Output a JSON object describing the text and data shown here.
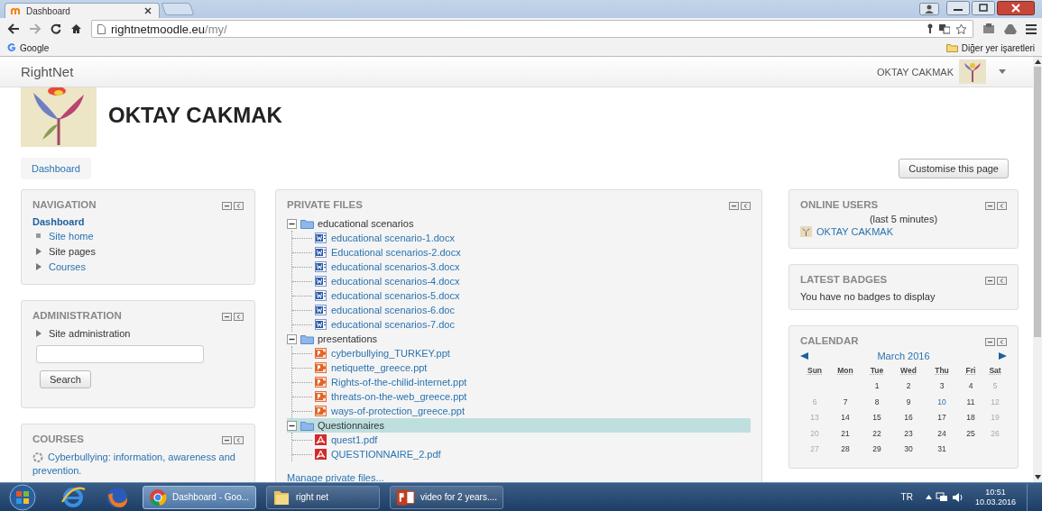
{
  "browser": {
    "tab": {
      "title": "Dashboard"
    },
    "address": {
      "host": "rightnetmoodle.eu",
      "path": "/my/"
    },
    "bookmarks": {
      "items": [
        "Google"
      ],
      "other": "Diğer yer işaretleri"
    }
  },
  "navbar": {
    "brand": "RightNet",
    "user": "OKTAY CAKMAK"
  },
  "header": {
    "name": "OKTAY CAKMAK"
  },
  "breadcrumb": [
    "Dashboard"
  ],
  "customise_button": "Customise this page",
  "navigation": {
    "title": "NAVIGATION",
    "current": "Dashboard",
    "items": [
      {
        "label": "Site home",
        "kind": "leaf",
        "link": true
      },
      {
        "label": "Site pages",
        "kind": "branch",
        "link": false
      },
      {
        "label": "Courses",
        "kind": "branch",
        "link": true
      }
    ]
  },
  "administration": {
    "title": "ADMINISTRATION",
    "items": [
      {
        "label": "Site administration",
        "kind": "branch",
        "link": false
      }
    ],
    "search_button": "Search"
  },
  "courses": {
    "title": "COURSES",
    "items": [
      "Cyberbullying: information, awareness and prevention."
    ]
  },
  "private_files": {
    "title": "PRIVATE FILES",
    "folders": [
      {
        "name": "educational scenarios",
        "expanded": true,
        "selected": false,
        "children": [
          {
            "name": "educational scenario-1.docx",
            "kind": "word"
          },
          {
            "name": "Educational scenarios-2.docx",
            "kind": "word"
          },
          {
            "name": "educational scenarios-3.docx",
            "kind": "word"
          },
          {
            "name": "educational scenarios-4.docx",
            "kind": "word"
          },
          {
            "name": "educational scenarios-5.docx",
            "kind": "word"
          },
          {
            "name": "educational scenarios-6.doc",
            "kind": "word"
          },
          {
            "name": "educational scenarios-7.doc",
            "kind": "word"
          }
        ]
      },
      {
        "name": "presentations",
        "expanded": true,
        "selected": false,
        "children": [
          {
            "name": "cyberbullying_TURKEY.ppt",
            "kind": "ppt"
          },
          {
            "name": "netiquette_greece.ppt",
            "kind": "ppt"
          },
          {
            "name": "Rights-of-the-chilid-internet.ppt",
            "kind": "ppt"
          },
          {
            "name": "threats-on-the-web_greece.ppt",
            "kind": "ppt"
          },
          {
            "name": "ways-of-protection_greece.ppt",
            "kind": "ppt"
          }
        ]
      },
      {
        "name": "Questionnaires",
        "expanded": true,
        "selected": true,
        "children": [
          {
            "name": "quest1.pdf",
            "kind": "pdf"
          },
          {
            "name": "QUESTIONNAIRE_2.pdf",
            "kind": "pdf"
          }
        ]
      }
    ],
    "manage_link": "Manage private files..."
  },
  "online_users": {
    "title": "ONLINE USERS",
    "note": "(last 5 minutes)",
    "users": [
      "OKTAY CAKMAK"
    ]
  },
  "latest_badges": {
    "title": "LATEST BADGES",
    "message": "You have no badges to display"
  },
  "calendar": {
    "title": "CALENDAR",
    "month": "March 2016",
    "weekdays": [
      "Sun",
      "Mon",
      "Tue",
      "Wed",
      "Thu",
      "Fri",
      "Sat"
    ],
    "weeks": [
      {
        "kind": "late_start",
        "days": [
          {
            "day": "1",
            "kind": "weekday"
          },
          {
            "day": "2",
            "kind": "weekday"
          },
          {
            "day": "3",
            "kind": "weekday"
          },
          {
            "day": "4",
            "kind": "weekday"
          },
          {
            "day": "5",
            "kind": "weekend"
          }
        ]
      },
      {
        "kind": "full",
        "days": [
          {
            "day": "6",
            "kind": "weekend"
          },
          {
            "day": "7",
            "kind": "weekday"
          },
          {
            "day": "8",
            "kind": "weekday"
          },
          {
            "day": "9",
            "kind": "weekday"
          },
          {
            "day": "10",
            "kind": "today"
          },
          {
            "day": "11",
            "kind": "weekday"
          },
          {
            "day": "12",
            "kind": "weekend"
          }
        ]
      },
      {
        "kind": "full",
        "days": [
          {
            "day": "13",
            "kind": "weekend"
          },
          {
            "day": "14",
            "kind": "weekday"
          },
          {
            "day": "15",
            "kind": "weekday"
          },
          {
            "day": "16",
            "kind": "weekday"
          },
          {
            "day": "17",
            "kind": "weekday"
          },
          {
            "day": "18",
            "kind": "weekday"
          },
          {
            "day": "19",
            "kind": "weekend"
          }
        ]
      },
      {
        "kind": "full",
        "days": [
          {
            "day": "20",
            "kind": "weekend"
          },
          {
            "day": "21",
            "kind": "weekday"
          },
          {
            "day": "22",
            "kind": "weekday"
          },
          {
            "day": "23",
            "kind": "weekday"
          },
          {
            "day": "24",
            "kind": "weekday"
          },
          {
            "day": "25",
            "kind": "weekday"
          },
          {
            "day": "26",
            "kind": "weekend"
          }
        ]
      },
      {
        "kind": "early_end",
        "days": [
          {
            "day": "27",
            "kind": "weekend"
          },
          {
            "day": "28",
            "kind": "weekday"
          },
          {
            "day": "29",
            "kind": "weekday"
          },
          {
            "day": "30",
            "kind": "weekday"
          },
          {
            "day": "31",
            "kind": "weekday"
          }
        ]
      }
    ]
  },
  "taskbar": {
    "windows": [
      {
        "label": "Dashboard - Goo...",
        "kind": "chrome",
        "selected": true
      },
      {
        "label": "right net",
        "kind": "folder",
        "selected": false
      },
      {
        "label": "video for 2 years....",
        "kind": "ppt",
        "selected": false
      }
    ],
    "language": "TR",
    "time": "10:51",
    "date": "10.03.2016"
  }
}
